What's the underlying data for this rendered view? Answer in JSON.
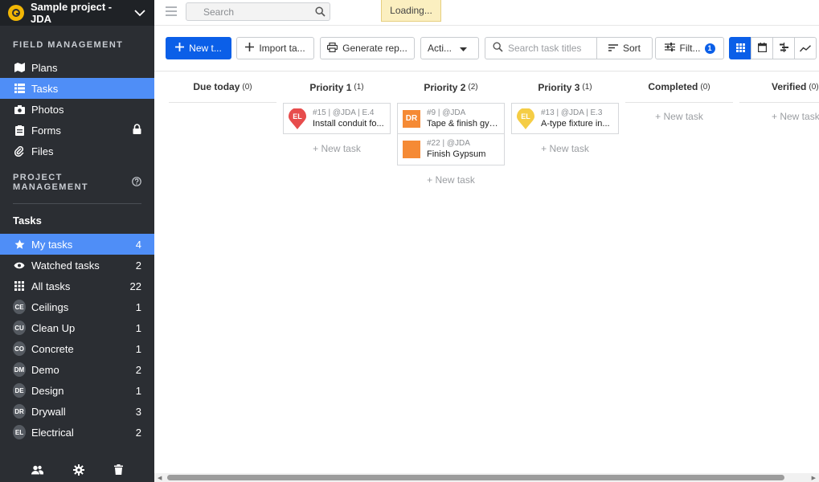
{
  "project": {
    "name": "Sample project - JDA"
  },
  "sidebar": {
    "field_management_title": "FIELD MANAGEMENT",
    "field_items": [
      {
        "label": "Plans"
      },
      {
        "label": "Tasks"
      },
      {
        "label": "Photos"
      },
      {
        "label": "Forms"
      },
      {
        "label": "Files"
      }
    ],
    "project_management_title": "PROJECT MANAGEMENT",
    "tasks_heading": "Tasks",
    "task_items": [
      {
        "label": "My tasks",
        "count": "4"
      },
      {
        "label": "Watched tasks",
        "count": "2"
      },
      {
        "label": "All tasks",
        "count": "22"
      },
      {
        "abbr": "CE",
        "label": "Ceilings",
        "count": "1"
      },
      {
        "abbr": "CU",
        "label": "Clean Up",
        "count": "1"
      },
      {
        "abbr": "CO",
        "label": "Concrete",
        "count": "1"
      },
      {
        "abbr": "DM",
        "label": "Demo",
        "count": "2"
      },
      {
        "abbr": "DE",
        "label": "Design",
        "count": "1"
      },
      {
        "abbr": "DR",
        "label": "Drywall",
        "count": "3"
      },
      {
        "abbr": "EL",
        "label": "Electrical",
        "count": "2"
      }
    ]
  },
  "topbar": {
    "search_placeholder": "Search",
    "loading_text": "Loading..."
  },
  "toolbar": {
    "new_task": "New t...",
    "import_tasks": "Import ta...",
    "generate_report": "Generate rep...",
    "actions": "Acti...",
    "search_placeholder": "Search task titles",
    "sort": "Sort",
    "filter": "Filt...",
    "filter_count": "1"
  },
  "board": {
    "columns": [
      {
        "title": "Due today",
        "count": "(0)",
        "new_task": ""
      },
      {
        "title": "Priority 1",
        "count": "(1)",
        "new_task": "+ New task"
      },
      {
        "title": "Priority 2",
        "count": "(2)",
        "new_task": "+ New task"
      },
      {
        "title": "Priority 3",
        "count": "(1)",
        "new_task": "+ New task"
      },
      {
        "title": "Completed",
        "count": "(0)",
        "new_task": "+ New task"
      },
      {
        "title": "Verified",
        "count": "(0)",
        "new_task": "+ New task"
      }
    ],
    "cards": {
      "p1_0": {
        "badge": "EL",
        "meta": "#15 | @JDA | E.4",
        "title": "Install conduit fo..."
      },
      "p2_0": {
        "badge": "DR",
        "meta": "#9 | @JDA",
        "title": "Tape & finish gyp..."
      },
      "p2_1": {
        "badge": "",
        "meta": "#22 | @JDA",
        "title": "Finish Gypsum"
      },
      "p3_0": {
        "badge": "EL",
        "meta": "#13 | @JDA | E.3",
        "title": "A-type fixture in..."
      }
    }
  },
  "colors": {
    "accent": "#0b5fe8",
    "sidebar_active": "#4f8ef7",
    "sidebar_bg": "#2b2e33",
    "pin_red": "#e74c4c",
    "square_orange": "#f58a35",
    "pin_yellow": "#f5cd45"
  }
}
